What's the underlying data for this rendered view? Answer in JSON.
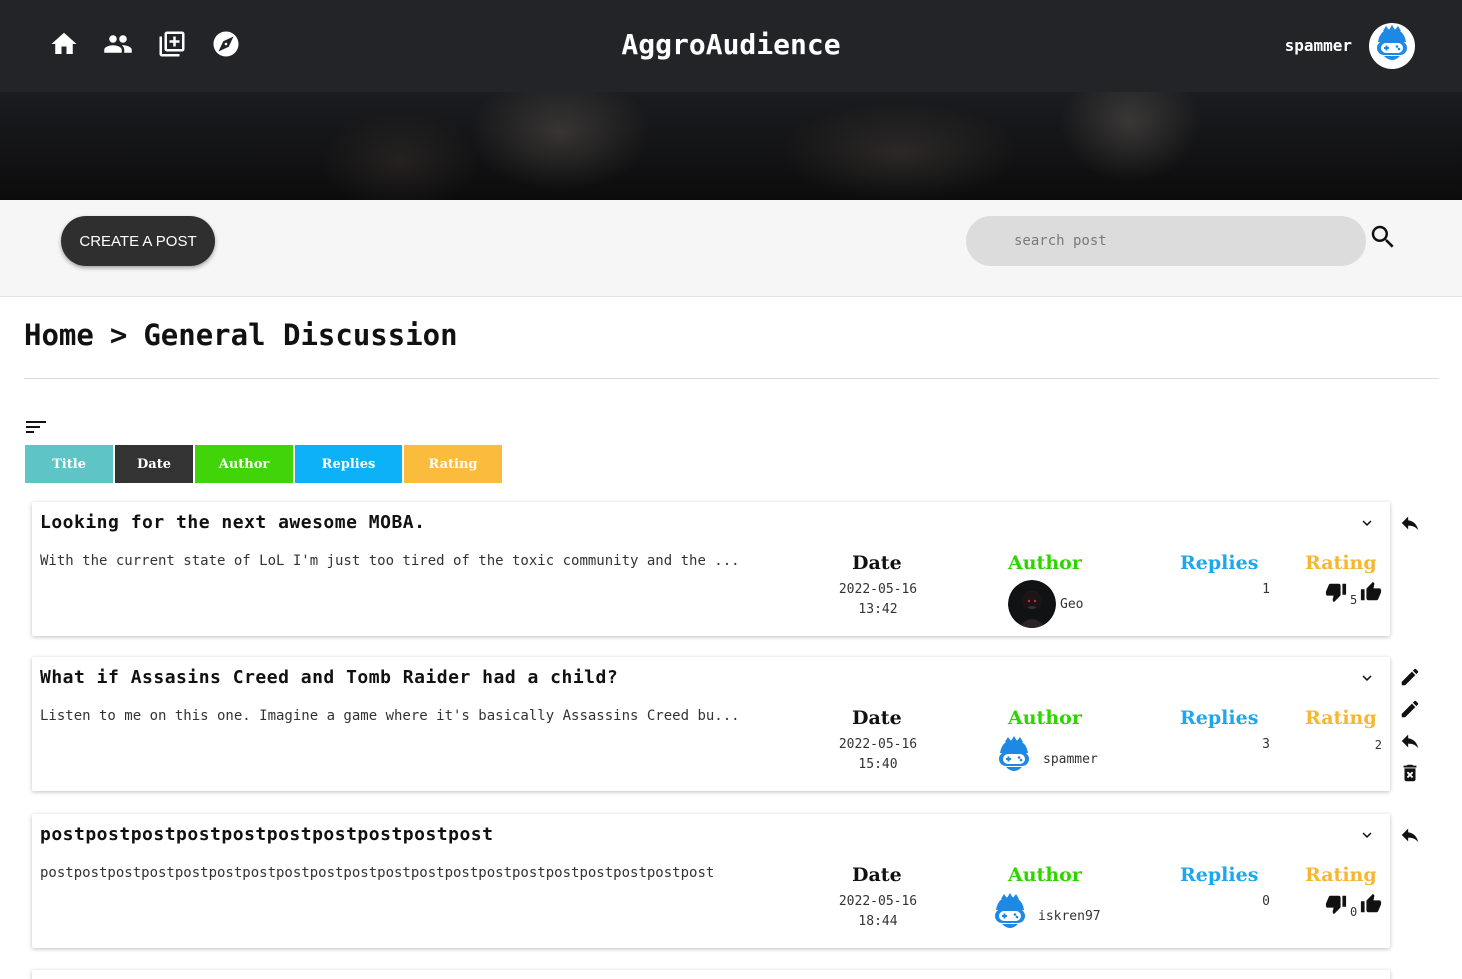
{
  "header": {
    "app_title": "AggroAudience",
    "username": "spammer",
    "nav_icons": [
      "home-icon",
      "people-icon",
      "add-post-icon",
      "explore-icon"
    ]
  },
  "toolbar": {
    "create_label": "CREATE A POST",
    "search_placeholder": "search post"
  },
  "breadcrumb": {
    "home": "Home",
    "separator": ">",
    "current": "General Discussion"
  },
  "sort_tabs": [
    {
      "label": "Title",
      "color": "#5ec4c6"
    },
    {
      "label": "Date",
      "color": "#333333"
    },
    {
      "label": "Author",
      "color": "#41d408"
    },
    {
      "label": "Replies",
      "color": "#0cb1f7"
    },
    {
      "label": "Rating",
      "color": "#fbbb3c"
    }
  ],
  "columns": {
    "date": "Date",
    "author": "Author",
    "replies": "Replies",
    "rating": "Rating"
  },
  "posts": [
    {
      "title": "Looking for the next awesome MOBA.",
      "excerpt": "With the current state of LoL I'm just too tired of the toxic community and the ...",
      "date": "2022-05-16",
      "time": "13:42",
      "author": "Geo",
      "replies": "1",
      "rating": "5"
    },
    {
      "title": "What if Assasins Creed and Tomb Raider had a child?",
      "excerpt": "Listen to me on this one. Imagine a game where it's basically Assassins Creed bu...",
      "date": "2022-05-16",
      "time": "15:40",
      "author": "spammer",
      "replies": "3",
      "rating": "2"
    },
    {
      "title": "postpostpostpostpostpostpostpostpostpost",
      "excerpt": "postpostpostpostpostpostpostpostpostpostpostpostpostpostpostpostpostpostpostpost",
      "date": "2022-05-16",
      "time": "18:44",
      "author": "iskren97",
      "replies": "0",
      "rating": "0"
    }
  ]
}
